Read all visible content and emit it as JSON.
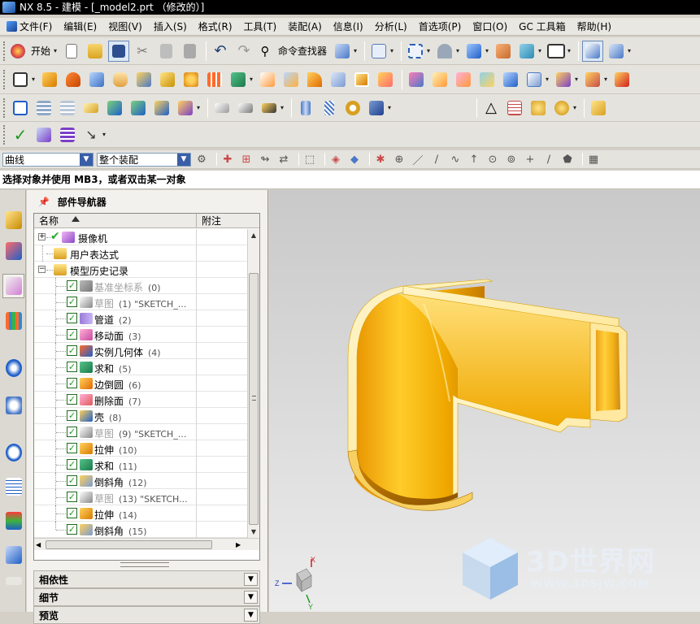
{
  "window": {
    "title": "NX 8.5 - 建模 - [_model2.prt （修改的）]"
  },
  "menubar": {
    "items": [
      "文件(F)",
      "编辑(E)",
      "视图(V)",
      "插入(S)",
      "格式(R)",
      "工具(T)",
      "装配(A)",
      "信息(I)",
      "分析(L)",
      "首选项(P)",
      "窗口(O)",
      "GC 工具箱",
      "帮助(H)"
    ]
  },
  "toolbar": {
    "start_label": "开始",
    "command_finder_label": "命令查找器"
  },
  "selection_bar": {
    "filter_value": "曲线",
    "scope_value": "整个装配"
  },
  "cue_line": "选择对象并使用 MB3，或者双击某一对象",
  "navigator": {
    "title": "部件导航器",
    "col_name": "名称",
    "col_note": "附注",
    "items": [
      {
        "label": "摄像机",
        "num": "",
        "dim": false
      },
      {
        "label": "用户表达式",
        "num": "",
        "dim": false
      },
      {
        "label": "模型历史记录",
        "num": "",
        "dim": false
      },
      {
        "label": "基准坐标系",
        "num": "(0)",
        "dim": true
      },
      {
        "label": "草图",
        "num": "(1) \"SKETCH_...",
        "dim": true
      },
      {
        "label": "管道",
        "num": "(2)",
        "dim": false
      },
      {
        "label": "移动面",
        "num": "(3)",
        "dim": false
      },
      {
        "label": "实例几何体",
        "num": "(4)",
        "dim": false
      },
      {
        "label": "求和",
        "num": "(5)",
        "dim": false
      },
      {
        "label": "边倒圆",
        "num": "(6)",
        "dim": false
      },
      {
        "label": "删除面",
        "num": "(7)",
        "dim": false
      },
      {
        "label": "壳",
        "num": "(8)",
        "dim": false
      },
      {
        "label": "草图",
        "num": "(9) \"SKETCH_...",
        "dim": true
      },
      {
        "label": "拉伸",
        "num": "(10)",
        "dim": false
      },
      {
        "label": "求和",
        "num": "(11)",
        "dim": false
      },
      {
        "label": "倒斜角",
        "num": "(12)",
        "dim": false
      },
      {
        "label": "草图",
        "num": "(13) \"SKETCH...",
        "dim": true
      },
      {
        "label": "拉伸",
        "num": "(14)",
        "dim": false
      },
      {
        "label": "倒斜角",
        "num": "(15)",
        "dim": false
      }
    ],
    "panel_dependencies": "相依性",
    "panel_details": "细节",
    "panel_preview": "预览"
  },
  "viewport": {
    "model_color": "#f0a800",
    "background_top": "#c9c9c9",
    "background_bottom": "#ececec",
    "axis_labels": {
      "x": "X",
      "y": "Y",
      "z": "Z"
    },
    "watermark_text": "3D世界网",
    "watermark_url": "WWW.3DSJW.COM"
  },
  "colors": {
    "title_bg": "#000000",
    "selection_arrow": "#3a5fa8",
    "check_green": "#1f9a1f"
  }
}
